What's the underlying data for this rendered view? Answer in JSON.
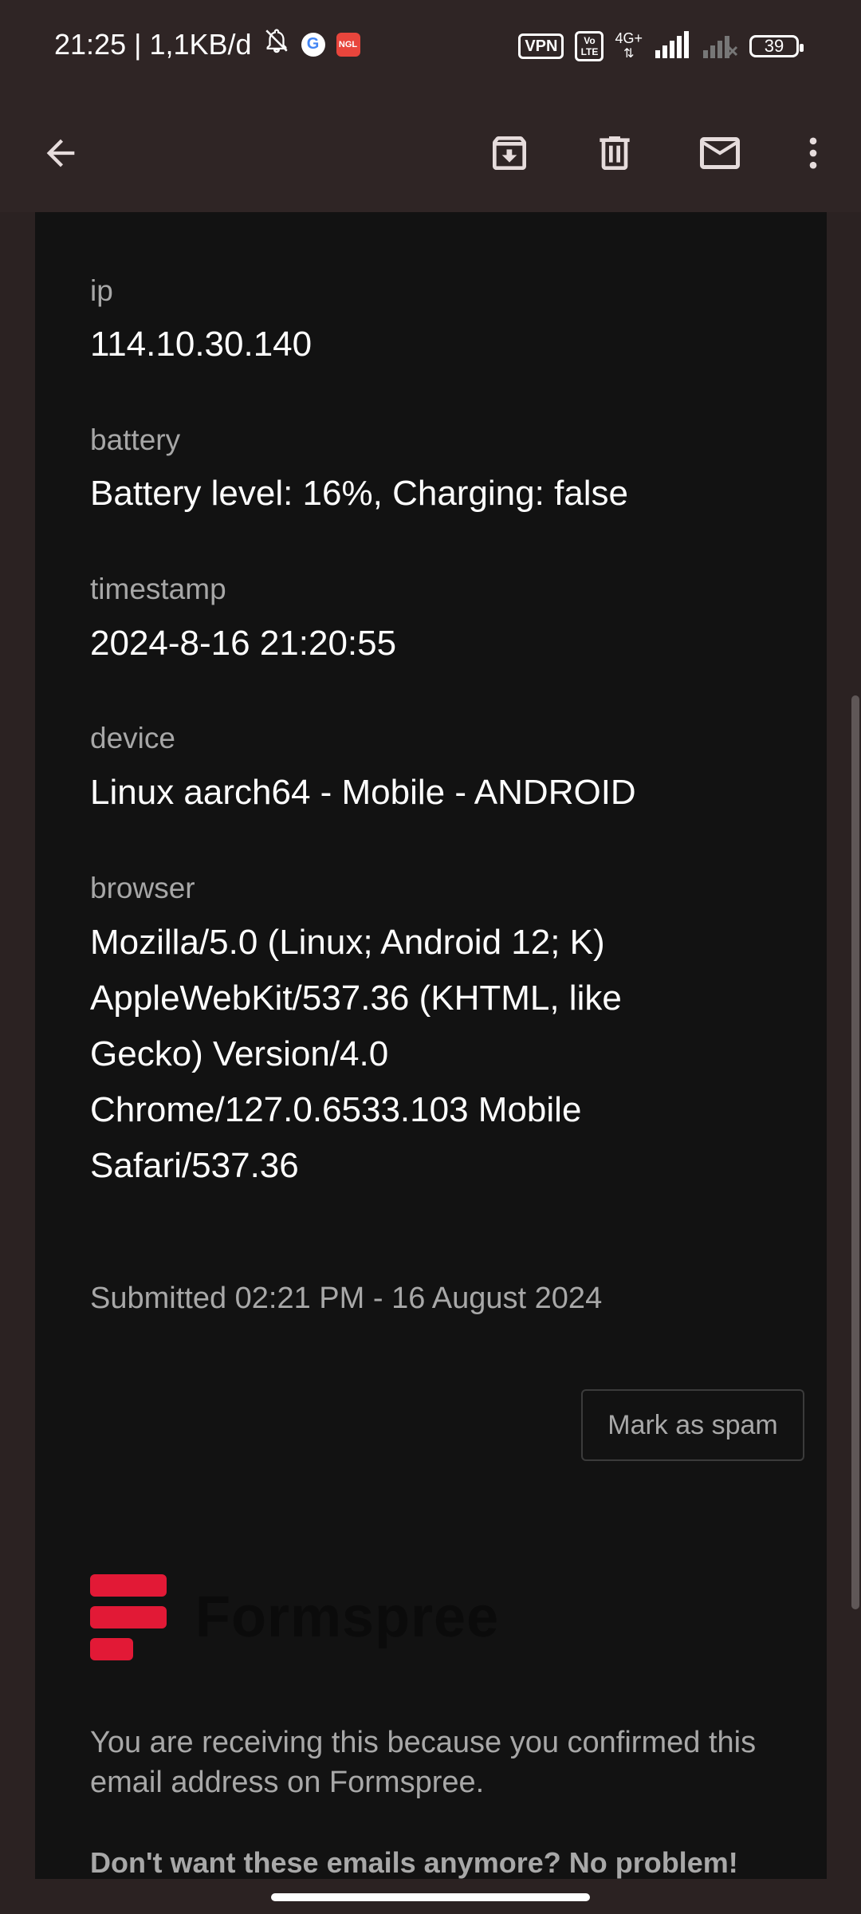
{
  "status_bar": {
    "time_speed": "21:25 | 1,1KB/d",
    "vpn": "VPN",
    "volte": "Vo LTE",
    "network": "4G+",
    "battery": "39",
    "app_icon_label": "NGL"
  },
  "app_bar": {
    "icons": [
      "back-arrow-icon",
      "archive-icon",
      "delete-icon",
      "mail-icon",
      "more-vert-icon"
    ]
  },
  "fields": [
    {
      "label": "ip",
      "value": "114.10.30.140"
    },
    {
      "label": "battery",
      "value": "Battery level: 16%, Charging: false"
    },
    {
      "label": "timestamp",
      "value": "2024-8-16 21:20:55"
    },
    {
      "label": "device",
      "value": "Linux aarch64 - Mobile - ANDROID"
    },
    {
      "label": "browser",
      "value": "Mozilla/5.0 (Linux; Android 12; K) AppleWebKit/537.36 (KHTML, like Gecko) Version/4.0 Chrome/127.0.6533.103 Mobile Safari/537.36"
    }
  ],
  "submitted": "Submitted 02:21 PM - 16 August 2024",
  "spam_button": "Mark as spam",
  "brand": {
    "name": "Formspree",
    "accent": "#e21936"
  },
  "notice": "You are receiving this because you confirmed this email address on Formspree.",
  "unsubscribe": "Don't want these emails anymore? No problem!"
}
